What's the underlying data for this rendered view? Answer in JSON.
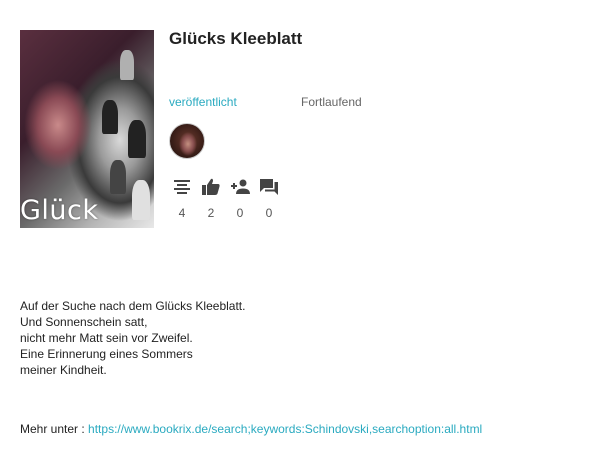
{
  "book": {
    "cover_title": "Glück",
    "title": "Glücks Kleeblatt",
    "status": "veröffentlicht",
    "progress": "Fortlaufend"
  },
  "stats": [
    {
      "icon": "chapters-icon",
      "count": "4"
    },
    {
      "icon": "like-icon",
      "count": "2"
    },
    {
      "icon": "follower-icon",
      "count": "0"
    },
    {
      "icon": "comments-icon",
      "count": "0"
    }
  ],
  "description": [
    "Auf der Suche nach dem Glücks Kleeblatt.",
    "Und Sonnenschein satt,",
    "nicht mehr Matt sein vor Zweifel.",
    "Eine Erinnerung eines Sommers",
    "meiner Kindheit."
  ],
  "more": {
    "label": "Mehr unter :",
    "link": "https://www.bookrix.de/search;keywords:Schindovski,searchoption:all.html"
  },
  "colors": {
    "accent": "#2aaac0",
    "icon": "#444444",
    "text": "#222222",
    "muted": "#666666"
  }
}
